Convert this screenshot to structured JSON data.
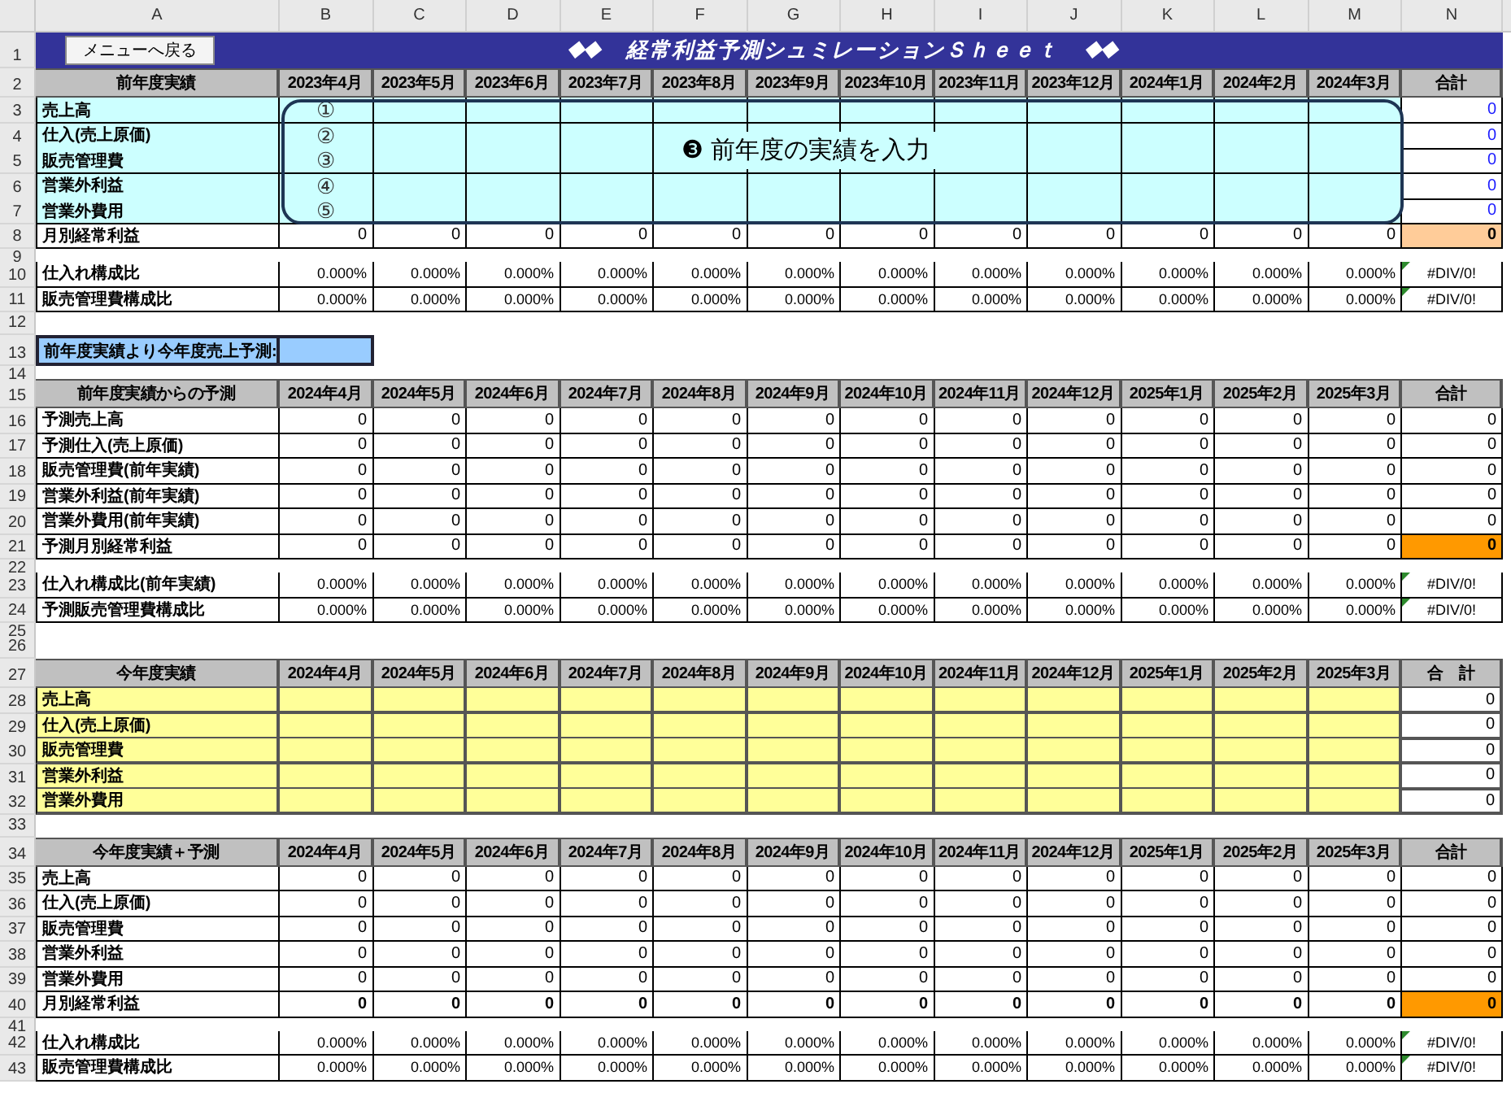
{
  "column_letters": [
    "A",
    "B",
    "C",
    "D",
    "E",
    "F",
    "G",
    "H",
    "I",
    "J",
    "K",
    "L",
    "M",
    "N"
  ],
  "callout": {
    "number": "❸",
    "text": "前年度の実績を入力"
  },
  "rows": [
    {
      "number": "1",
      "kind": "title",
      "button": "メニューへ戻る",
      "marks_left": "◆◆",
      "title": "経常利益予測シュミレーションＳｈｅｅｔ",
      "marks_right": "◆◆"
    },
    {
      "number": "2",
      "kind": "header",
      "label": "前年度実績",
      "cells": [
        "2023年4月",
        "2023年5月",
        "2023年6月",
        "2023年7月",
        "2023年8月",
        "2023年9月",
        "2023年10月",
        "2023年11月",
        "2023年12月",
        "2024年1月",
        "2024年2月",
        "2024年3月"
      ],
      "total": "合計"
    },
    {
      "number": "3",
      "kind": "input",
      "label": "売上高",
      "marker": "①",
      "color": "#ccffff",
      "total": {
        "text": "0",
        "color": "#1a1aff"
      }
    },
    {
      "number": "4",
      "kind": "input",
      "label": "仕入(売上原価)",
      "marker": "②",
      "color": "#ccffff",
      "total": {
        "text": "0",
        "color": "#1a1aff"
      }
    },
    {
      "number": "5",
      "kind": "input",
      "label": "販売管理費",
      "marker": "③",
      "color": "#ccffff",
      "total": {
        "text": "0",
        "color": "#1a1aff"
      }
    },
    {
      "number": "6",
      "kind": "input",
      "label": "営業外利益",
      "marker": "④",
      "color": "#ccffff",
      "total": {
        "text": "0",
        "color": "#1a1aff"
      }
    },
    {
      "number": "7",
      "kind": "input",
      "label": "営業外費用",
      "marker": "⑤",
      "color": "#ccffff",
      "total": {
        "text": "0",
        "color": "#1a1aff"
      }
    },
    {
      "number": "8",
      "kind": "value",
      "label": "月別経常利益",
      "cells": [
        "0",
        "0",
        "0",
        "0",
        "0",
        "0",
        "0",
        "0",
        "0",
        "0",
        "0",
        "0"
      ],
      "total": {
        "text": "0",
        "color": "#ffcc99"
      }
    },
    {
      "number": "9",
      "kind": "spacer"
    },
    {
      "number": "10",
      "kind": "percent",
      "label": "仕入れ構成比",
      "cells": [
        "0.000%",
        "0.000%",
        "0.000%",
        "0.000%",
        "0.000%",
        "0.000%",
        "0.000%",
        "0.000%",
        "0.000%",
        "0.000%",
        "0.000%",
        "0.000%"
      ],
      "total": "#DIV/0!"
    },
    {
      "number": "11",
      "kind": "percent",
      "label": "販売管理費構成比",
      "cells": [
        "0.000%",
        "0.000%",
        "0.000%",
        "0.000%",
        "0.000%",
        "0.000%",
        "0.000%",
        "0.000%",
        "0.000%",
        "0.000%",
        "0.000%",
        "0.000%"
      ],
      "total": "#DIV/0!"
    },
    {
      "number": "12",
      "kind": "blank"
    },
    {
      "number": "13",
      "kind": "forecast",
      "label": "前年度実績より今年度売上予測:",
      "color": "#99ccff"
    },
    {
      "number": "14",
      "kind": "spacer"
    },
    {
      "number": "15",
      "kind": "header",
      "label": "前年度実績からの予測",
      "cells": [
        "2024年4月",
        "2024年5月",
        "2024年6月",
        "2024年7月",
        "2024年8月",
        "2024年9月",
        "2024年10月",
        "2024年11月",
        "2024年12月",
        "2025年1月",
        "2025年2月",
        "2025年3月"
      ],
      "total": "合計"
    },
    {
      "number": "16",
      "kind": "value",
      "label": "予測売上高",
      "cells": [
        "0",
        "0",
        "0",
        "0",
        "0",
        "0",
        "0",
        "0",
        "0",
        "0",
        "0",
        "0"
      ],
      "total": {
        "text": "0"
      }
    },
    {
      "number": "17",
      "kind": "value",
      "label": "予測仕入(売上原価)",
      "cells": [
        "0",
        "0",
        "0",
        "0",
        "0",
        "0",
        "0",
        "0",
        "0",
        "0",
        "0",
        "0"
      ],
      "total": {
        "text": "0"
      }
    },
    {
      "number": "18",
      "kind": "value",
      "label": "販売管理費(前年実績)",
      "cells": [
        "0",
        "0",
        "0",
        "0",
        "0",
        "0",
        "0",
        "0",
        "0",
        "0",
        "0",
        "0"
      ],
      "total": {
        "text": "0"
      }
    },
    {
      "number": "19",
      "kind": "value",
      "label": "営業外利益(前年実績)",
      "cells": [
        "0",
        "0",
        "0",
        "0",
        "0",
        "0",
        "0",
        "0",
        "0",
        "0",
        "0",
        "0"
      ],
      "total": {
        "text": "0"
      }
    },
    {
      "number": "20",
      "kind": "value",
      "label": "営業外費用(前年実績)",
      "cells": [
        "0",
        "0",
        "0",
        "0",
        "0",
        "0",
        "0",
        "0",
        "0",
        "0",
        "0",
        "0"
      ],
      "total": {
        "text": "0"
      }
    },
    {
      "number": "21",
      "kind": "value",
      "label": "予測月別経常利益",
      "cells": [
        "0",
        "0",
        "0",
        "0",
        "0",
        "0",
        "0",
        "0",
        "0",
        "0",
        "0",
        "0"
      ],
      "total": {
        "text": "0",
        "color": "#ff9900"
      }
    },
    {
      "number": "22",
      "kind": "spacer"
    },
    {
      "number": "23",
      "kind": "percent",
      "label": "仕入れ構成比(前年実績)",
      "cells": [
        "0.000%",
        "0.000%",
        "0.000%",
        "0.000%",
        "0.000%",
        "0.000%",
        "0.000%",
        "0.000%",
        "0.000%",
        "0.000%",
        "0.000%",
        "0.000%"
      ],
      "total": "#DIV/0!"
    },
    {
      "number": "24",
      "kind": "percent",
      "label": "予測販売管理費構成比",
      "cells": [
        "0.000%",
        "0.000%",
        "0.000%",
        "0.000%",
        "0.000%",
        "0.000%",
        "0.000%",
        "0.000%",
        "0.000%",
        "0.000%",
        "0.000%",
        "0.000%"
      ],
      "total": "#DIV/0!"
    },
    {
      "number": "25",
      "kind": "spacer"
    },
    {
      "number": "26",
      "kind": "blank"
    },
    {
      "number": "27",
      "kind": "header",
      "label": "今年度実績",
      "cells": [
        "2024年4月",
        "2024年5月",
        "2024年6月",
        "2024年7月",
        "2024年8月",
        "2024年9月",
        "2024年10月",
        "2024年11月",
        "2024年12月",
        "2025年1月",
        "2025年2月",
        "2025年3月"
      ],
      "total": "合　計"
    },
    {
      "number": "28",
      "kind": "input",
      "label": "売上高",
      "color": "#ffff99",
      "total": {
        "text": "0",
        "color": "#000000"
      }
    },
    {
      "number": "29",
      "kind": "input",
      "label": "仕入(売上原価)",
      "color": "#ffff99",
      "total": {
        "text": "0",
        "color": "#000000"
      }
    },
    {
      "number": "30",
      "kind": "input",
      "label": "販売管理費",
      "color": "#ffff99",
      "total": {
        "text": "0",
        "color": "#000000"
      }
    },
    {
      "number": "31",
      "kind": "input",
      "label": "営業外利益",
      "color": "#ffff99",
      "total": {
        "text": "0",
        "color": "#000000"
      }
    },
    {
      "number": "32",
      "kind": "input",
      "label": "営業外費用",
      "color": "#ffff99",
      "total": {
        "text": "0",
        "color": "#000000"
      }
    },
    {
      "number": "33",
      "kind": "blank"
    },
    {
      "number": "34",
      "kind": "header",
      "label": "今年度実績＋予測",
      "cells": [
        "2024年4月",
        "2024年5月",
        "2024年6月",
        "2024年7月",
        "2024年8月",
        "2024年9月",
        "2024年10月",
        "2024年11月",
        "2024年12月",
        "2025年1月",
        "2025年2月",
        "2025年3月"
      ],
      "total": "合計"
    },
    {
      "number": "35",
      "kind": "value",
      "label": "売上高",
      "cells": [
        "0",
        "0",
        "0",
        "0",
        "0",
        "0",
        "0",
        "0",
        "0",
        "0",
        "0",
        "0"
      ],
      "total": {
        "text": "0"
      }
    },
    {
      "number": "36",
      "kind": "value",
      "label": "仕入(売上原価)",
      "cells": [
        "0",
        "0",
        "0",
        "0",
        "0",
        "0",
        "0",
        "0",
        "0",
        "0",
        "0",
        "0"
      ],
      "total": {
        "text": "0"
      }
    },
    {
      "number": "37",
      "kind": "value",
      "label": "販売管理費",
      "cells": [
        "0",
        "0",
        "0",
        "0",
        "0",
        "0",
        "0",
        "0",
        "0",
        "0",
        "0",
        "0"
      ],
      "total": {
        "text": "0"
      }
    },
    {
      "number": "38",
      "kind": "value",
      "label": "営業外利益",
      "cells": [
        "0",
        "0",
        "0",
        "0",
        "0",
        "0",
        "0",
        "0",
        "0",
        "0",
        "0",
        "0"
      ],
      "total": {
        "text": "0"
      }
    },
    {
      "number": "39",
      "kind": "value",
      "label": "営業外費用",
      "cells": [
        "0",
        "0",
        "0",
        "0",
        "0",
        "0",
        "0",
        "0",
        "0",
        "0",
        "0",
        "0"
      ],
      "total": {
        "text": "0"
      }
    },
    {
      "number": "40",
      "kind": "value",
      "label": "月別経常利益",
      "bold": true,
      "cells": [
        "0",
        "0",
        "0",
        "0",
        "0",
        "0",
        "0",
        "0",
        "0",
        "0",
        "0",
        "0"
      ],
      "total": {
        "text": "0",
        "color": "#ff9900"
      }
    },
    {
      "number": "41",
      "kind": "spacer"
    },
    {
      "number": "42",
      "kind": "percent",
      "label": "仕入れ構成比",
      "cells": [
        "0.000%",
        "0.000%",
        "0.000%",
        "0.000%",
        "0.000%",
        "0.000%",
        "0.000%",
        "0.000%",
        "0.000%",
        "0.000%",
        "0.000%",
        "0.000%"
      ],
      "total": "#DIV/0!"
    },
    {
      "number": "43",
      "kind": "percent",
      "label": "販売管理費構成比",
      "cells": [
        "0.000%",
        "0.000%",
        "0.000%",
        "0.000%",
        "0.000%",
        "0.000%",
        "0.000%",
        "0.000%",
        "0.000%",
        "0.000%",
        "0.000%",
        "0.000%"
      ],
      "total": "#DIV/0!"
    }
  ]
}
